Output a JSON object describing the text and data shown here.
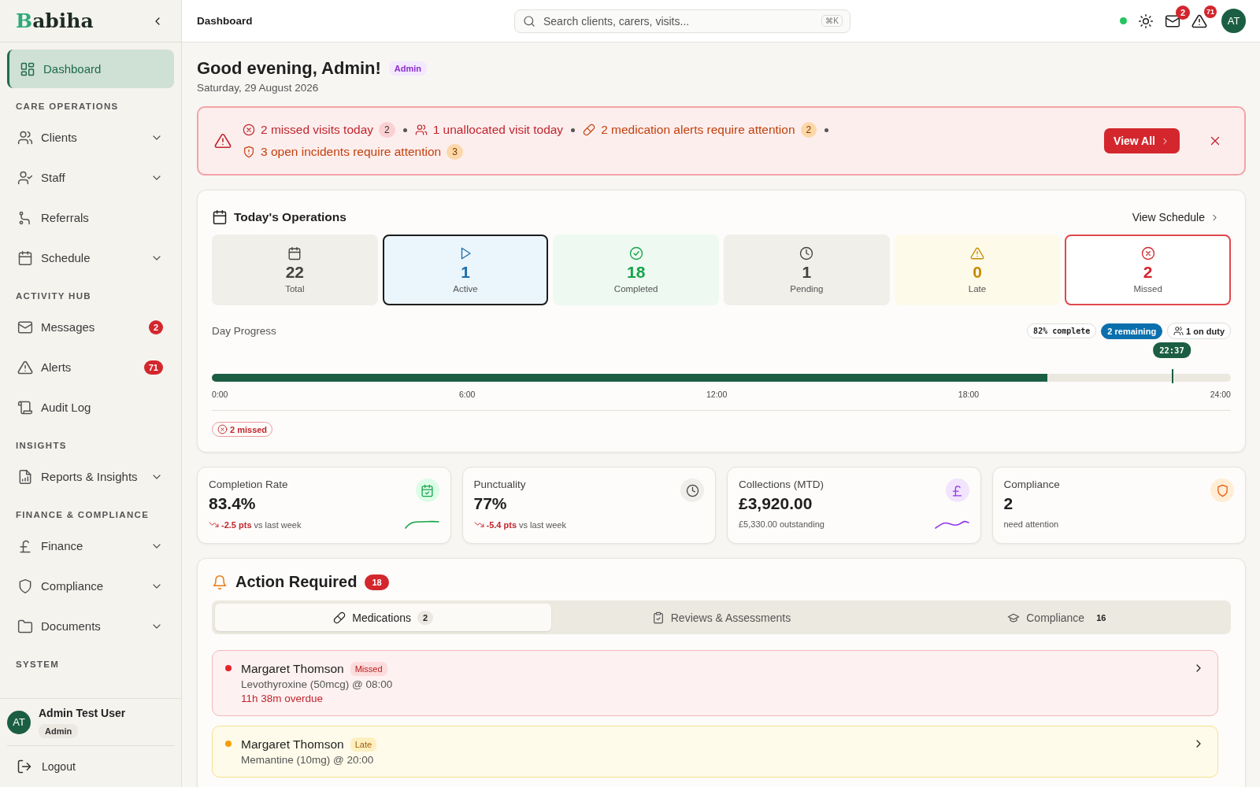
{
  "sidebar": {
    "logo": "Babiha",
    "sections": [
      {
        "items": [
          {
            "label": "Dashboard",
            "selected": true,
            "expandable": false
          }
        ]
      },
      {
        "title": "CARE OPERATIONS",
        "items": [
          {
            "label": "Clients",
            "selected": false,
            "expandable": true
          },
          {
            "label": "Staff",
            "selected": false,
            "expandable": true
          },
          {
            "label": "Referrals",
            "selected": false,
            "expandable": false
          },
          {
            "label": "Schedule",
            "selected": false,
            "expandable": true
          }
        ]
      },
      {
        "title": "ACTIVITY HUB",
        "items": [
          {
            "label": "Messages",
            "selected": false,
            "expandable": false,
            "badge": "2"
          },
          {
            "label": "Alerts",
            "selected": false,
            "expandable": false,
            "badge": "71"
          },
          {
            "label": "Audit Log",
            "selected": false,
            "expandable": false
          }
        ]
      },
      {
        "title": "INSIGHTS",
        "items": [
          {
            "label": "Reports & Insights",
            "selected": false,
            "expandable": true
          }
        ]
      },
      {
        "title": "FINANCE & COMPLIANCE",
        "items": [
          {
            "label": "Finance",
            "selected": false,
            "expandable": true
          },
          {
            "label": "Compliance",
            "selected": false,
            "expandable": true
          },
          {
            "label": "Documents",
            "selected": false,
            "expandable": true
          }
        ]
      },
      {
        "title": "SYSTEM"
      }
    ],
    "user": {
      "initials": "AT",
      "name": "Admin Test User",
      "role": "Admin"
    },
    "logout": "Logout"
  },
  "header": {
    "title": "Dashboard",
    "search": {
      "placeholder": "Search clients, carers, visits...",
      "shortcut": "⌘K"
    },
    "online": true,
    "messages_badge": "2",
    "alerts_badge": "71",
    "avatar": "AT"
  },
  "greeting": {
    "title": "Good evening, Admin!",
    "role": "Admin",
    "date": "Saturday, 29 August 2026"
  },
  "alert_banner": {
    "items": [
      {
        "kind": "missed",
        "text": "2 missed visits today",
        "count": "2"
      },
      {
        "kind": "unallocated",
        "text": "1 unallocated visit today"
      },
      {
        "kind": "medication",
        "text": "2 medication alerts require attention",
        "count": "2"
      },
      {
        "kind": "incident",
        "text": "3 open incidents require attention",
        "count": "3"
      }
    ],
    "button": "View All"
  },
  "operations": {
    "title": "Today's Operations",
    "link": "View Schedule",
    "tiles": [
      {
        "kind": "total",
        "value": "22",
        "label": "Total",
        "selected": false
      },
      {
        "kind": "active",
        "value": "1",
        "label": "Active",
        "selected": true
      },
      {
        "kind": "completed",
        "value": "18",
        "label": "Completed",
        "selected": false
      },
      {
        "kind": "pending",
        "value": "1",
        "label": "Pending",
        "selected": false
      },
      {
        "kind": "late",
        "value": "0",
        "label": "Late",
        "selected": false
      },
      {
        "kind": "missed",
        "value": "2",
        "label": "Missed",
        "selected": false
      }
    ],
    "progress": {
      "label": "Day Progress",
      "complete": "82% complete",
      "remaining": "2 remaining",
      "on_duty": "1 on duty",
      "level": 0.82,
      "now": {
        "label": "22:37",
        "level": 0.942
      },
      "ticks": [
        "0:00",
        "6:00",
        "12:00",
        "18:00",
        "24:00"
      ],
      "missed": "2 missed"
    }
  },
  "stats": [
    {
      "kind": "completion",
      "label": "Completion Rate",
      "value": "83.4%",
      "delta": "-2.5 pts",
      "note": "vs last week",
      "sparkline": true
    },
    {
      "kind": "punctuality",
      "label": "Punctuality",
      "value": "77%",
      "delta": "-5.4 pts",
      "note": "vs last week",
      "sparkline": false
    },
    {
      "kind": "collections",
      "label": "Collections (MTD)",
      "value": "£3,920.00",
      "note": "£5,330.00 outstanding",
      "sparkline": true
    },
    {
      "kind": "compliance",
      "label": "Compliance",
      "value": "2",
      "note": "need attention",
      "sparkline": false
    }
  ],
  "action_required": {
    "title": "Action Required",
    "count": "18",
    "tabs": [
      {
        "label": "Medications",
        "count": "2",
        "selected": true
      },
      {
        "label": "Reviews & Assessments",
        "selected": false
      },
      {
        "label": "Compliance",
        "count": "16",
        "selected": false
      }
    ],
    "items": [
      {
        "kind": "missed",
        "name": "Margaret Thomson",
        "status": "Missed",
        "detail": "Levothyroxine (50mcg) @ 08:00",
        "overdue": "11h 38m overdue"
      },
      {
        "kind": "late",
        "name": "Margaret Thomson",
        "status": "Late",
        "detail": "Memantine (10mg) @ 20:00"
      }
    ]
  }
}
